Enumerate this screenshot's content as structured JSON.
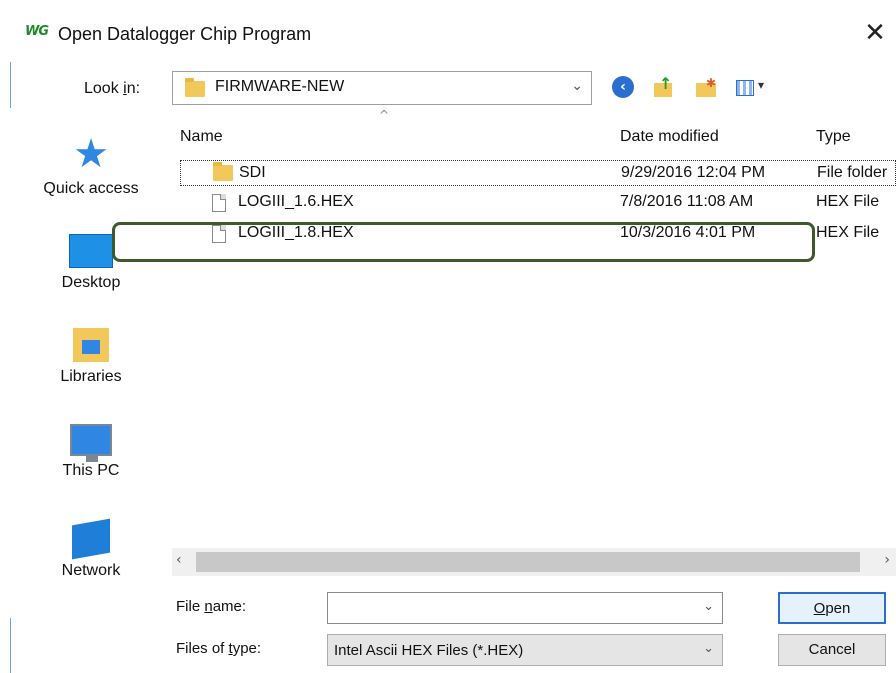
{
  "window": {
    "app_badge": "WG",
    "title": "Open Datalogger Chip Program",
    "close_glyph": "✕"
  },
  "toolbar": {
    "look_in_label": "Look in:",
    "look_in_accesskey_prefix": "Look ",
    "look_in_accesskey": "i",
    "look_in_accesskey_suffix": "n:",
    "current_folder": "FIRMWARE-NEW",
    "icons": [
      "back-icon",
      "up-folder-icon",
      "new-folder-icon",
      "view-menu-icon"
    ]
  },
  "places": [
    {
      "label": "Quick access",
      "icon": "star-icon"
    },
    {
      "label": "Desktop",
      "icon": "desktop-icon"
    },
    {
      "label": "Libraries",
      "icon": "libraries-icon"
    },
    {
      "label": "This PC",
      "icon": "pc-icon"
    },
    {
      "label": "Network",
      "icon": "network-icon"
    }
  ],
  "columns": {
    "name": "Name",
    "date": "Date modified",
    "type": "Type"
  },
  "files": [
    {
      "name": "SDI",
      "date": "9/29/2016 12:04 PM",
      "type": "File folder",
      "kind": "folder"
    },
    {
      "name": "LOGIII_1.6.HEX",
      "date": "7/8/2016 11:08 AM",
      "type": "HEX File",
      "kind": "file"
    },
    {
      "name": "LOGIII_1.8.HEX",
      "date": "10/3/2016 4:01 PM",
      "type": "HEX File",
      "kind": "file"
    }
  ],
  "form": {
    "file_name_prefix": "File ",
    "file_name_accesskey": "n",
    "file_name_suffix": "ame:",
    "file_name_value": "",
    "files_of_type_prefix": "Files of ",
    "files_of_type_accesskey": "t",
    "files_of_type_suffix": "ype:",
    "files_of_type_value": "Intel Ascii HEX Files (*.HEX)"
  },
  "buttons": {
    "open_accesskey": "O",
    "open_rest": "pen",
    "cancel": "Cancel"
  },
  "colors": {
    "highlight_box": "#3c5a2c",
    "accent": "#2a6fcf"
  }
}
